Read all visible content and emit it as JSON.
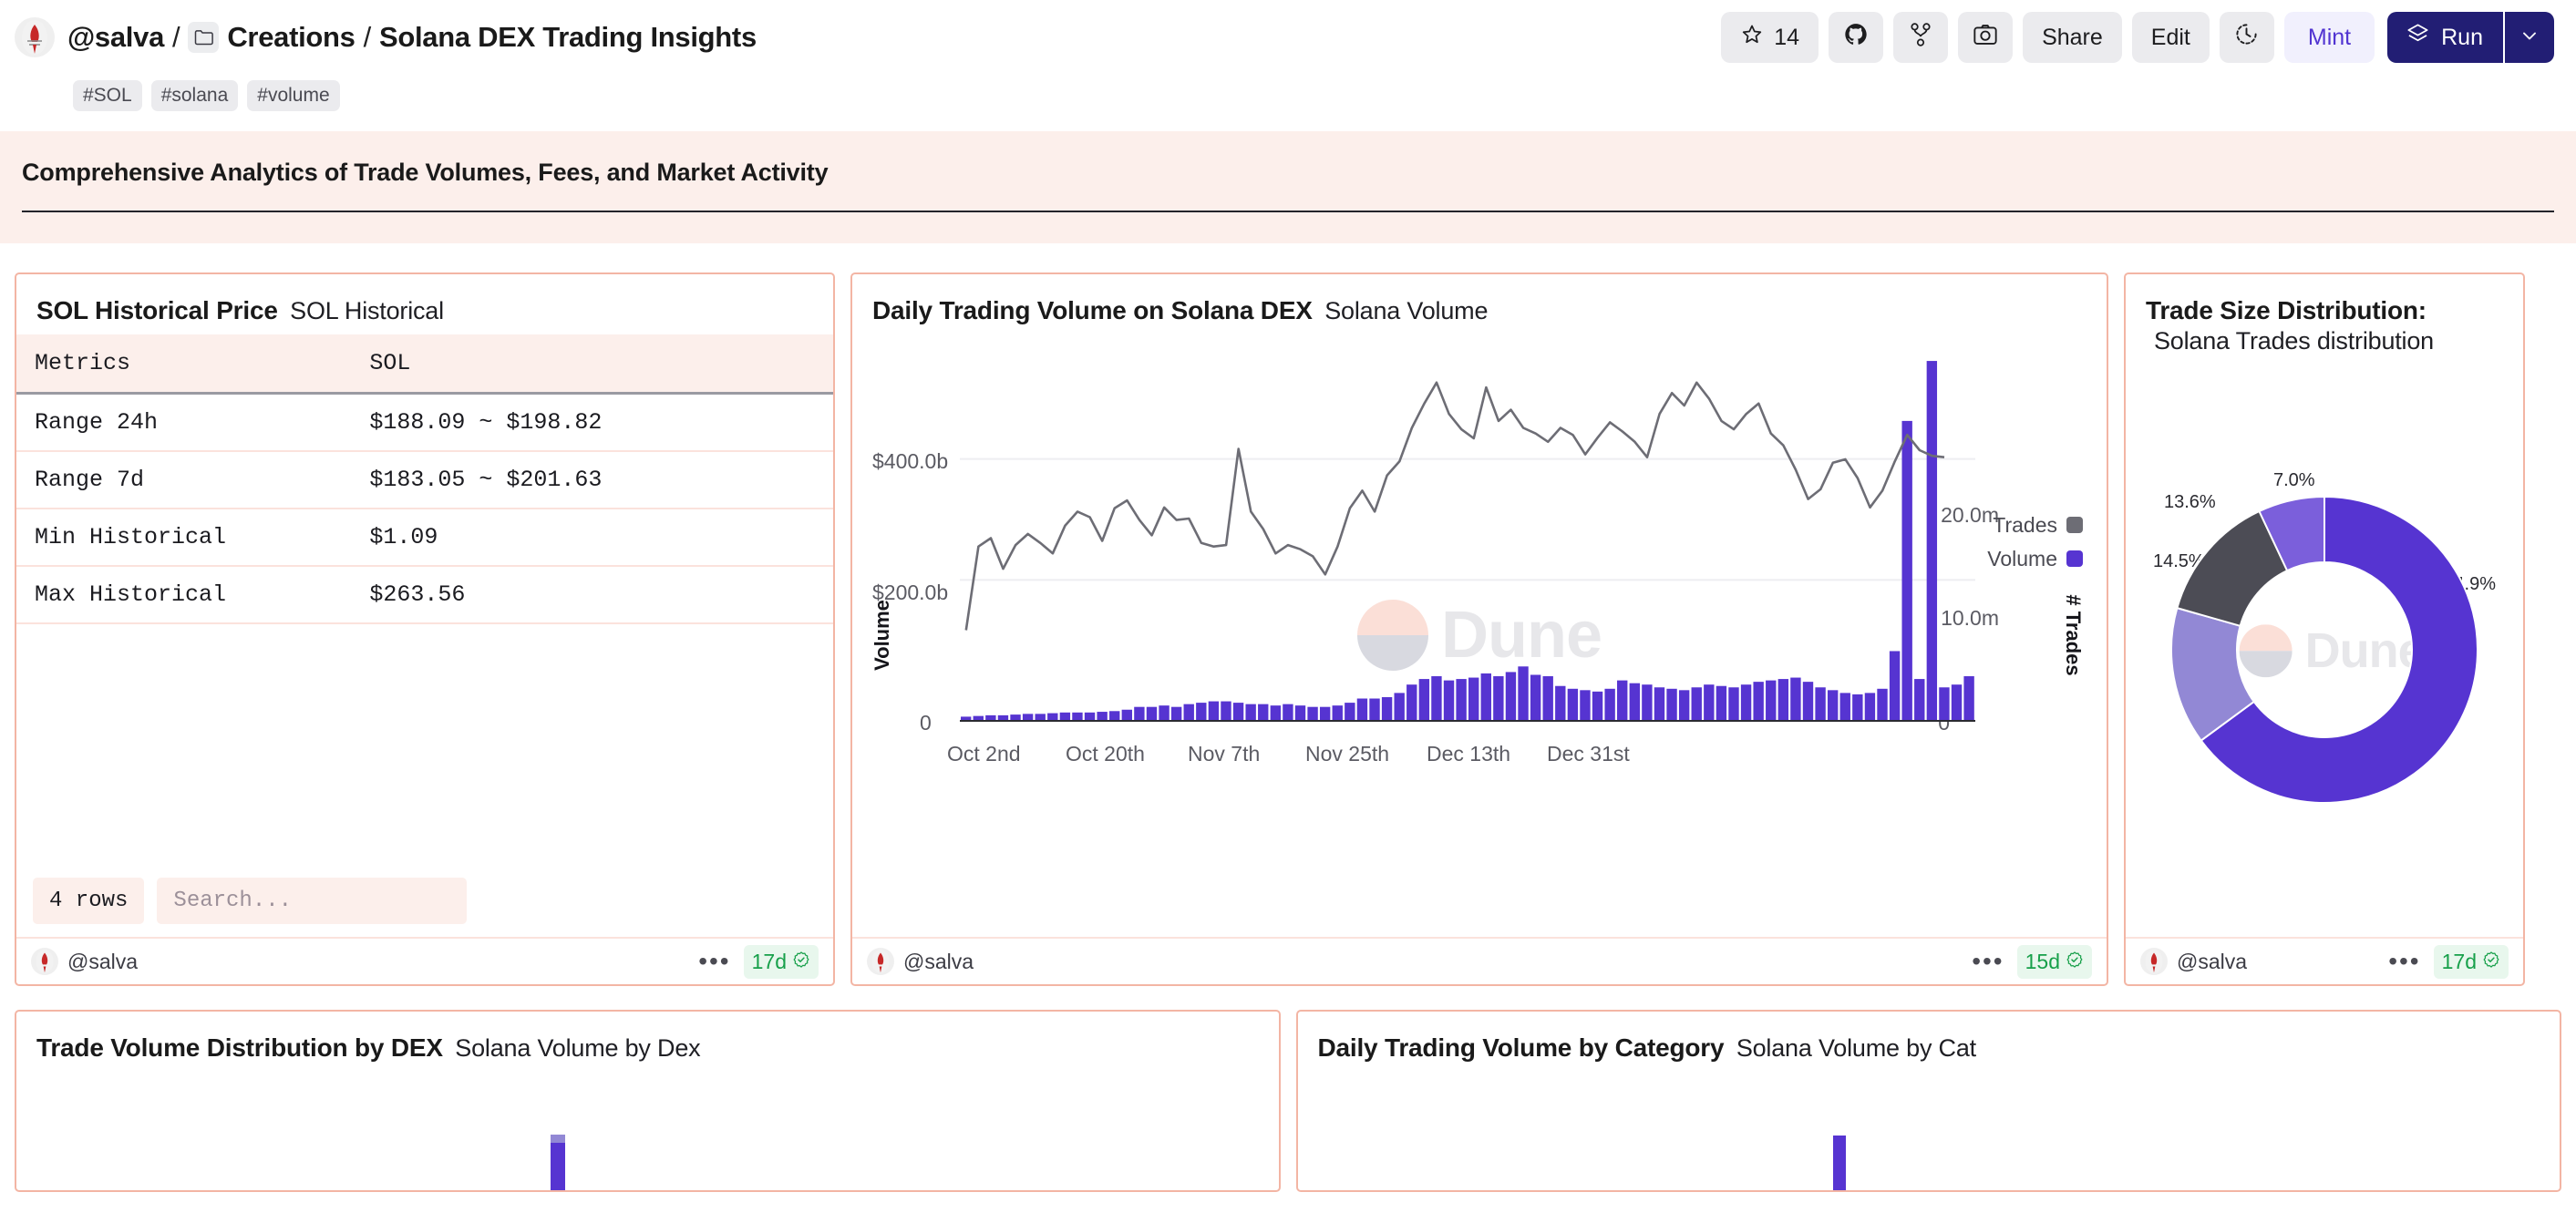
{
  "header": {
    "breadcrumb": {
      "user": "@salva",
      "sep1": "/",
      "folder": "Creations",
      "sep2": "/",
      "title": "Solana DEX Trading Insights"
    },
    "toolbar": {
      "star_count": "14",
      "star_icon": "star-icon",
      "github_icon": "github-icon",
      "fork_icon": "fork-icon",
      "camera_icon": "camera-icon",
      "share_label": "Share",
      "edit_label": "Edit",
      "history_icon": "clock-history-icon",
      "mint_label": "Mint",
      "run_label": "Run",
      "run_icon": "layers-icon",
      "run_caret_icon": "chevron-down-icon",
      "run_bg": "#221e74",
      "mint_color": "#5134d1"
    }
  },
  "tags": [
    "#SOL",
    "#solana",
    "#volume"
  ],
  "description": {
    "title": "Comprehensive Analytics of Trade Volumes, Fees, and Market Activity",
    "bg": "#fcefeb"
  },
  "panels": {
    "sol_price": {
      "title": "SOL Historical Price",
      "subtitle": "SOL Historical",
      "columns": [
        "Metrics",
        "SOL"
      ],
      "rows": [
        [
          "Range 24h",
          "$188.09 ~ $198.82"
        ],
        [
          "Range 7d",
          "$183.05 ~ $201.63"
        ],
        [
          "Min Historical",
          "$1.09"
        ],
        [
          "Max Historical",
          "$263.56"
        ]
      ],
      "row_count_label": "4 rows",
      "search_placeholder": "Search...",
      "search_value": "",
      "author": "@salva",
      "age": "17d",
      "verified_icon": "verified-badge-icon",
      "more_icon": "more-options-icon"
    },
    "daily_volume": {
      "title": "Daily Trading Volume on Solana DEX",
      "subtitle": "Solana Volume",
      "author": "@salva",
      "age": "15d",
      "watermark": "Dune"
    },
    "trade_size": {
      "title": "Trade Size Distribution:",
      "subtitle": "Solana Trades distribution",
      "author": "@salva",
      "age": "17d",
      "watermark": "Dune"
    },
    "volume_by_dex": {
      "title": "Trade Volume Distribution by DEX",
      "subtitle": "Solana Volume by Dex"
    },
    "volume_by_cat": {
      "title": "Daily Trading Volume by Category",
      "subtitle": "Solana Volume by Cat"
    }
  },
  "chart_data": [
    {
      "id": "daily_volume",
      "type": "line",
      "title": "Daily Trading Volume on Solana DEX",
      "subtitle": "Solana Volume",
      "xlabel": "",
      "ylabel": "Volume",
      "y2label": "# Trades",
      "yticks": [
        "$400.0b",
        "$200.0b",
        "0"
      ],
      "y2ticks": [
        "20.0m",
        "10.0m",
        "0"
      ],
      "xticks": [
        "Oct 2nd",
        "Oct 20th",
        "Nov 7th",
        "Nov 25th",
        "Dec 13th",
        "Dec 31st"
      ],
      "ylim": [
        0,
        520
      ],
      "y2lim": [
        0,
        26
      ],
      "grid": true,
      "legend": [
        {
          "name": "Trades",
          "color": "#6d6d75"
        },
        {
          "name": "Volume",
          "color": "#5634d1"
        }
      ],
      "series": [
        {
          "name": "Trades",
          "type": "line",
          "color": "#6d6d75",
          "axis": "left",
          "values": [
            130,
            250,
            262,
            218,
            252,
            268,
            255,
            240,
            280,
            300,
            292,
            258,
            305,
            316,
            288,
            266,
            306,
            288,
            290,
            255,
            250,
            252,
            390,
            300,
            275,
            240,
            252,
            246,
            236,
            210,
            250,
            305,
            330,
            300,
            352,
            372,
            420,
            455,
            485,
            440,
            418,
            405,
            478,
            430,
            446,
            420,
            412,
            400,
            420,
            410,
            382,
            406,
            428,
            415,
            400,
            378,
            440,
            470,
            452,
            485,
            462,
            430,
            418,
            440,
            455,
            412,
            395,
            360,
            318,
            332,
            370,
            375,
            348,
            306,
            330,
            372,
            410,
            388,
            380,
            378
          ]
        },
        {
          "name": "Volume",
          "type": "bar",
          "color": "#5634d1",
          "axis": "right",
          "values": [
            0.3,
            0.35,
            0.4,
            0.4,
            0.45,
            0.5,
            0.5,
            0.55,
            0.6,
            0.6,
            0.6,
            0.65,
            0.7,
            0.8,
            1.0,
            1.0,
            1.1,
            1.0,
            1.2,
            1.3,
            1.4,
            1.4,
            1.3,
            1.2,
            1.2,
            1.1,
            1.2,
            1.1,
            1.0,
            1.0,
            1.1,
            1.3,
            1.6,
            1.6,
            1.7,
            2.0,
            2.6,
            3.0,
            3.2,
            2.9,
            3.0,
            3.1,
            3.4,
            3.2,
            3.5,
            3.9,
            3.3,
            3.2,
            2.5,
            2.3,
            2.2,
            2.1,
            2.3,
            2.9,
            2.7,
            2.6,
            2.4,
            2.3,
            2.2,
            2.4,
            2.6,
            2.5,
            2.4,
            2.6,
            2.8,
            2.9,
            3.0,
            3.1,
            2.8,
            2.4,
            2.2,
            2.0,
            1.9,
            2.0,
            2.3,
            5.0,
            21.5,
            3.0,
            25.8,
            2.4,
            2.6,
            3.2
          ]
        }
      ]
    },
    {
      "id": "trade_size",
      "type": "pie",
      "title": "Trade Size Distribution:",
      "subtitle": "Solana Trades distribution",
      "labels": [
        "64.9%",
        "14.5%",
        "13.6%",
        "7.0%"
      ],
      "values": [
        64.9,
        14.5,
        13.6,
        7.0
      ],
      "colors": [
        "#5634d1",
        "#9288d5",
        "#4c4c55",
        "#7b5fdb"
      ],
      "donut": true,
      "watermark": "Dune"
    },
    {
      "id": "volume_by_dex",
      "type": "bar",
      "title": "Trade Volume Distribution by DEX",
      "subtitle": "Solana Volume by Dex",
      "stacked": true,
      "series": [
        {
          "name": "segment-top",
          "color": "#9288d5",
          "values": [
            0.3
          ]
        },
        {
          "name": "segment-main",
          "color": "#5634d1",
          "values": [
            2.4
          ]
        }
      ]
    },
    {
      "id": "volume_by_cat",
      "type": "bar",
      "title": "Daily Trading Volume by Category",
      "subtitle": "Solana Volume by Cat",
      "stacked": true,
      "series": [
        {
          "name": "segment-main",
          "color": "#5634d1",
          "values": [
            2.6
          ]
        }
      ]
    }
  ]
}
